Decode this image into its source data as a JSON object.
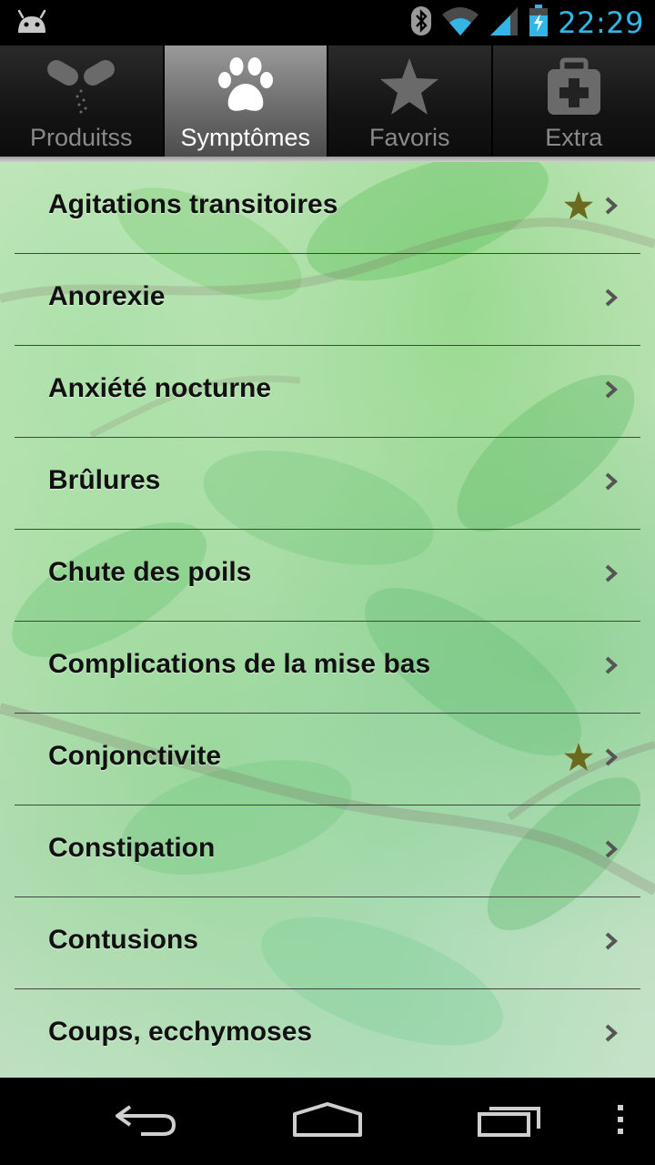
{
  "status_bar": {
    "time": "22:29",
    "icons": [
      "android-icon",
      "bluetooth-icon",
      "wifi-icon",
      "signal-icon",
      "battery-charging-icon"
    ],
    "accent_color": "#33b5e5"
  },
  "tabs": [
    {
      "label": "Produitss",
      "icon": "pills-icon",
      "active": false
    },
    {
      "label": "Symptômes",
      "icon": "paw-icon",
      "active": true
    },
    {
      "label": "Favoris",
      "icon": "star-icon",
      "active": false
    },
    {
      "label": "Extra",
      "icon": "first-aid-kit-icon",
      "active": false
    }
  ],
  "symptoms": [
    {
      "label": "Agitations transitoires",
      "favorite": true
    },
    {
      "label": "Anorexie",
      "favorite": false
    },
    {
      "label": "Anxiété nocturne",
      "favorite": false
    },
    {
      "label": "Brûlures",
      "favorite": false
    },
    {
      "label": "Chute des poils",
      "favorite": false
    },
    {
      "label": "Complications de la mise bas",
      "favorite": false
    },
    {
      "label": "Conjonctivite",
      "favorite": true
    },
    {
      "label": "Constipation",
      "favorite": false
    },
    {
      "label": "Contusions",
      "favorite": false
    },
    {
      "label": "Coups, ecchymoses",
      "favorite": false
    }
  ],
  "colors": {
    "favorite_star": "#6b6a1e",
    "chevron": "#555555",
    "row_text": "#111111"
  },
  "nav_bar": {
    "buttons": [
      "back-icon",
      "home-icon",
      "recent-apps-icon",
      "overflow-menu-icon"
    ]
  }
}
